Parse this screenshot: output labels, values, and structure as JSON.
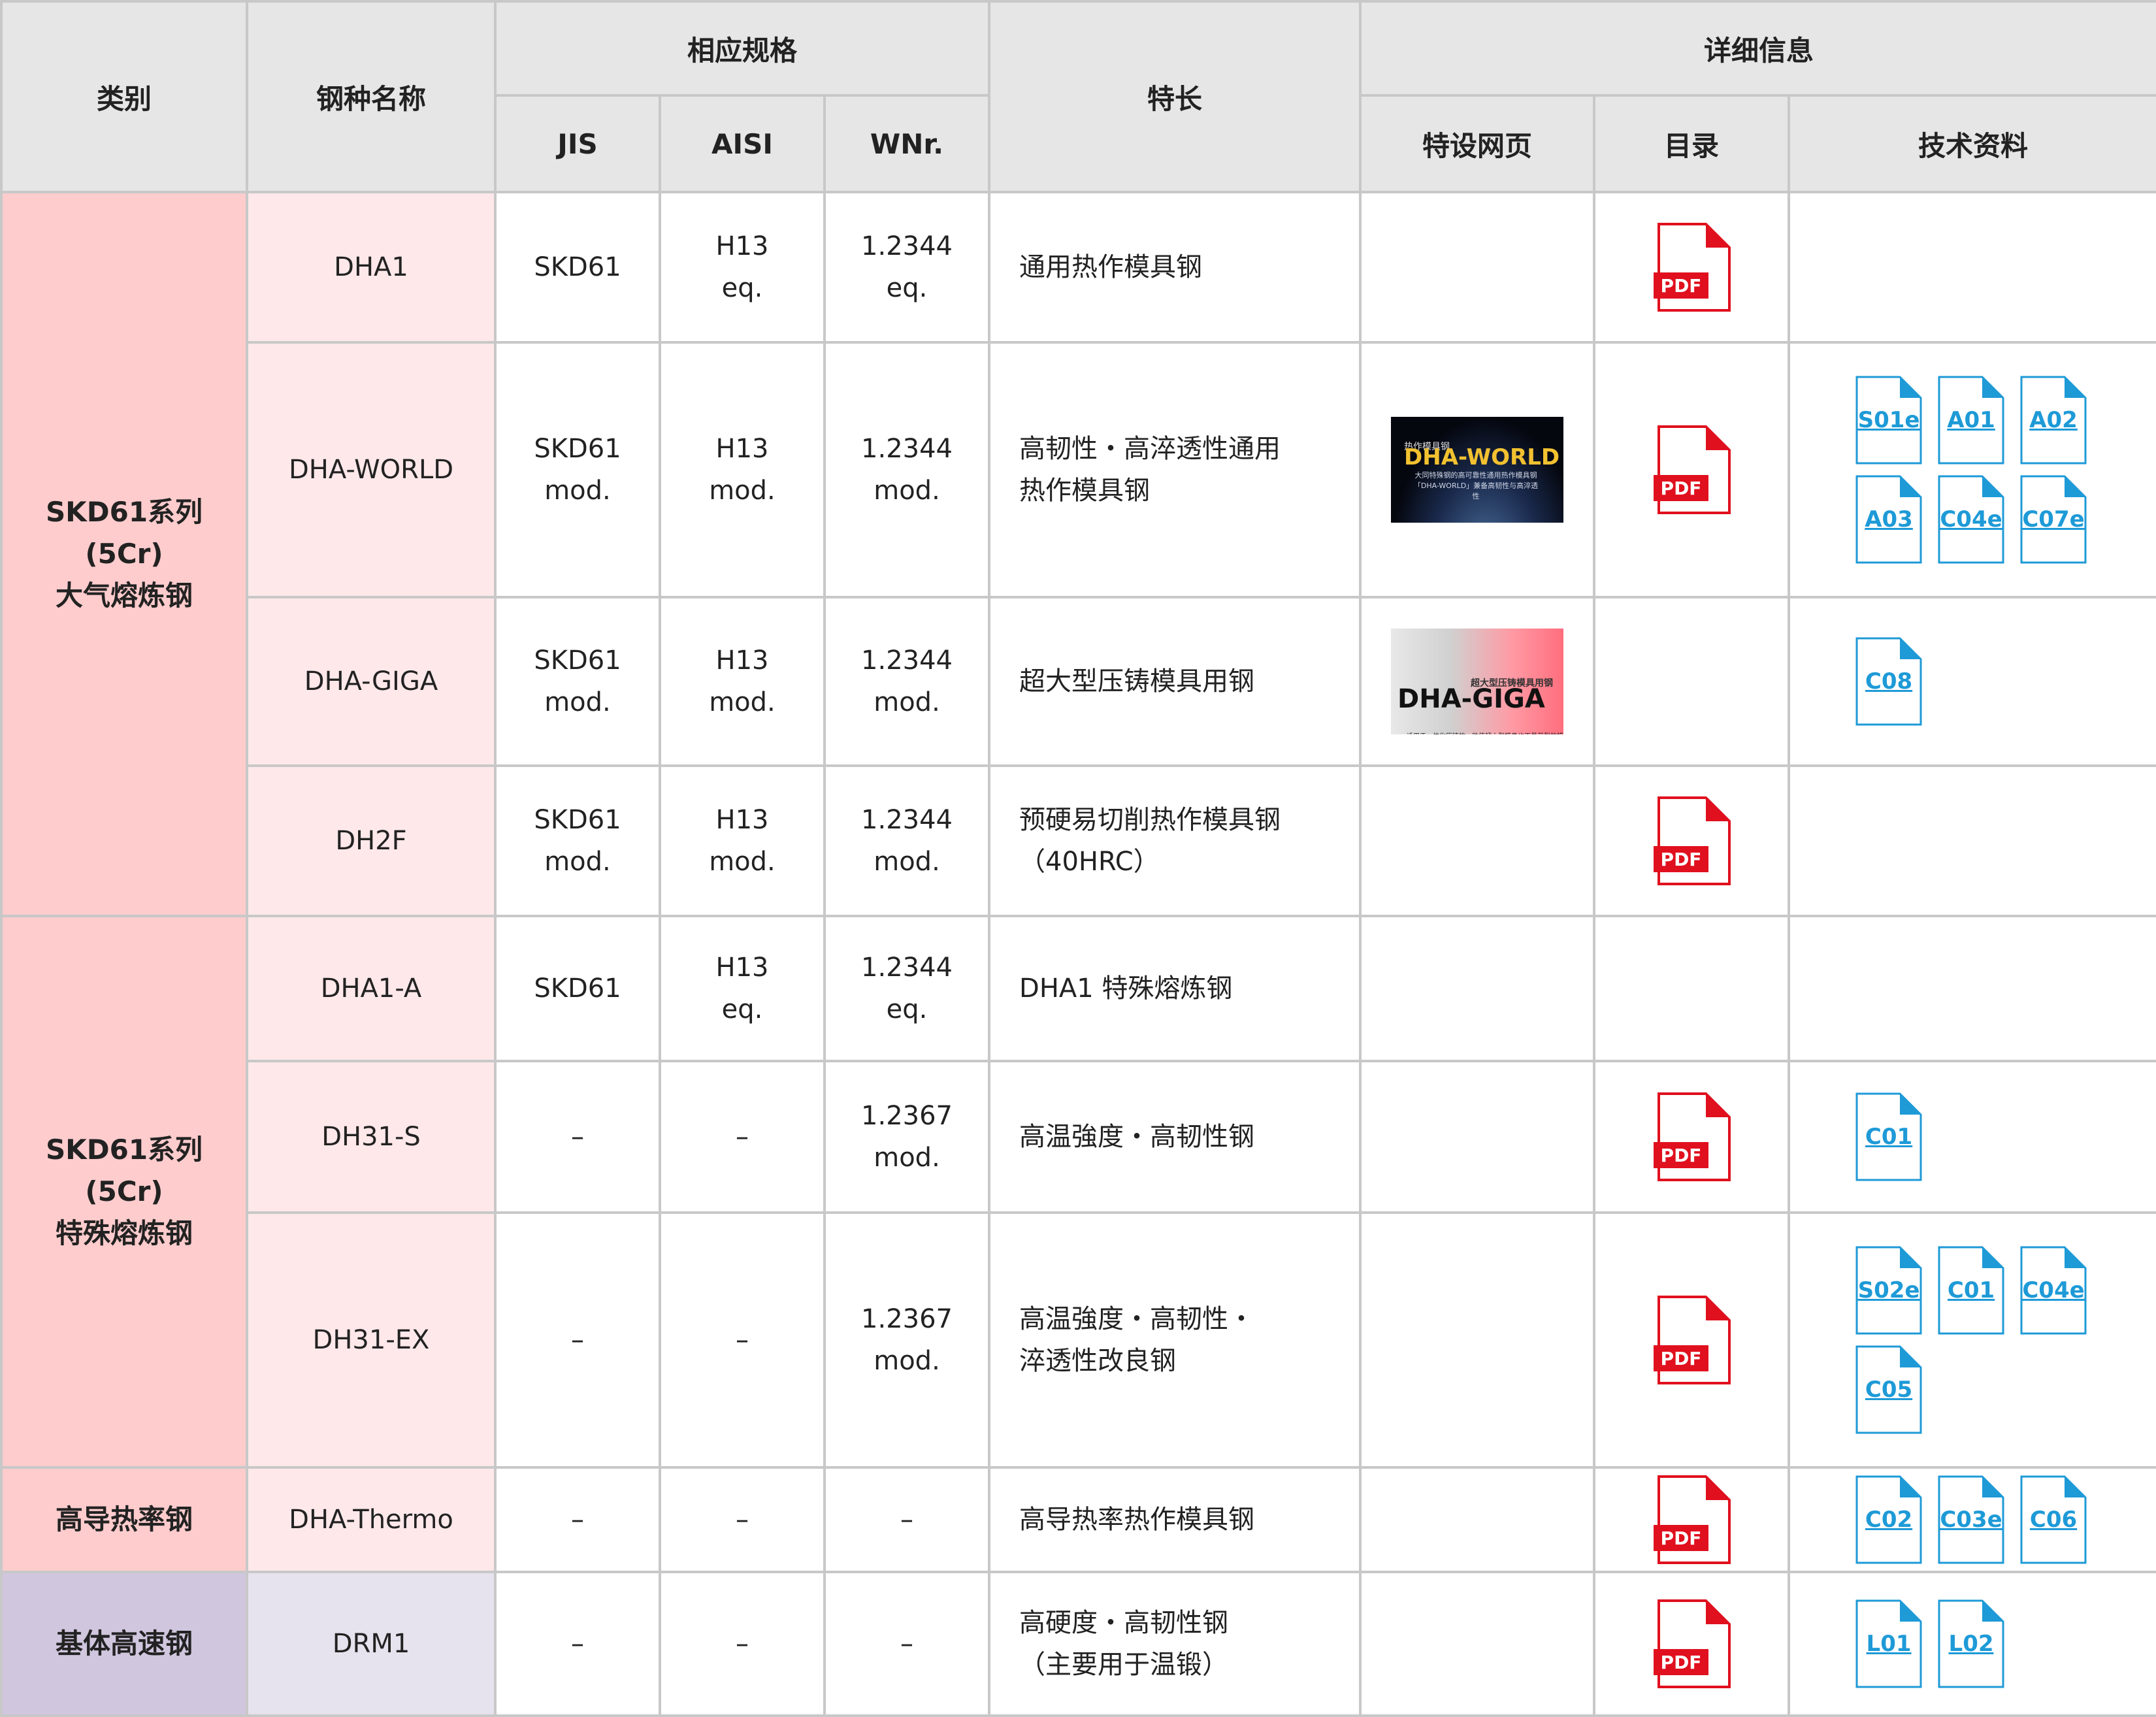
{
  "headers": {
    "category": "类别",
    "steel_name": "钢种名称",
    "standards": "相应规格",
    "jis": "JIS",
    "aisi": "AISI",
    "wnr": "WNr.",
    "features": "特长",
    "details": "详细信息",
    "special_page": "特设网页",
    "catalog": "目录",
    "tech_docs": "技术资料"
  },
  "categories": {
    "c1": "SKD61系列\n(5Cr)\n大气熔炼钢",
    "c2": "SKD61系列\n(5Cr)\n特殊熔炼钢",
    "c3": "高导热率钢",
    "c4": "基体高速钢"
  },
  "pdf_label": "PDF",
  "thumbs": {
    "world": {
      "sub": "热作模具钢",
      "title": "DHA-WORLD",
      "text": "大同特殊钢的高可靠性通用热作模具钢「DHA-WORLD」兼备高韧性与高淬透性"
    },
    "giga": {
      "sub": "超大型压铸模具用钢",
      "title": "DHA-GIGA",
      "text": "一适用于一体化压铸的、助使超大型模具也不易开裂的模具钢一"
    }
  },
  "rows": [
    {
      "name": "DHA1",
      "jis": "SKD61",
      "aisi": "H13\neq.",
      "wnr": "1.2344\neq.",
      "feature": "通用热作模具钢",
      "docs": []
    },
    {
      "name": "DHA-WORLD",
      "jis": "SKD61\nmod.",
      "aisi": "H13\nmod.",
      "wnr": "1.2344\nmod.",
      "feature": "高韧性・高淬透性通用\n热作模具钢",
      "docs": [
        "S01e",
        "A01",
        "A02",
        "A03",
        "C04e",
        "C07e"
      ]
    },
    {
      "name": "DHA-GIGA",
      "jis": "SKD61\nmod.",
      "aisi": "H13\nmod.",
      "wnr": "1.2344\nmod.",
      "feature": "超大型压铸模具用钢",
      "docs": [
        "C08"
      ]
    },
    {
      "name": "DH2F",
      "jis": "SKD61\nmod.",
      "aisi": "H13\nmod.",
      "wnr": "1.2344\nmod.",
      "feature": "预硬易切削热作模具钢\n（40HRC）",
      "docs": []
    },
    {
      "name": "DHA1-A",
      "jis": "SKD61",
      "aisi": "H13\neq.",
      "wnr": "1.2344\neq.",
      "feature": "DHA1 特殊熔炼钢",
      "docs": []
    },
    {
      "name": "DH31-S",
      "jis": "–",
      "aisi": "–",
      "wnr": "1.2367\nmod.",
      "feature": "高温強度・高韧性钢",
      "docs": [
        "C01"
      ]
    },
    {
      "name": "DH31-EX",
      "jis": "–",
      "aisi": "–",
      "wnr": "1.2367\nmod.",
      "feature": "高温強度・高韧性・\n淬透性改良钢",
      "docs": [
        "S02e",
        "C01",
        "C04e",
        "C05"
      ]
    },
    {
      "name": "DHA-Thermo",
      "jis": "–",
      "aisi": "–",
      "wnr": "–",
      "feature": "高导热率热作模具钢",
      "docs": [
        "C02",
        "C03e",
        "C06"
      ]
    },
    {
      "name": "DRM1",
      "jis": "–",
      "aisi": "–",
      "wnr": "–",
      "feature": "高硬度・高韧性钢\n（主要用于温锻）",
      "docs": [
        "L01",
        "L02"
      ]
    }
  ]
}
